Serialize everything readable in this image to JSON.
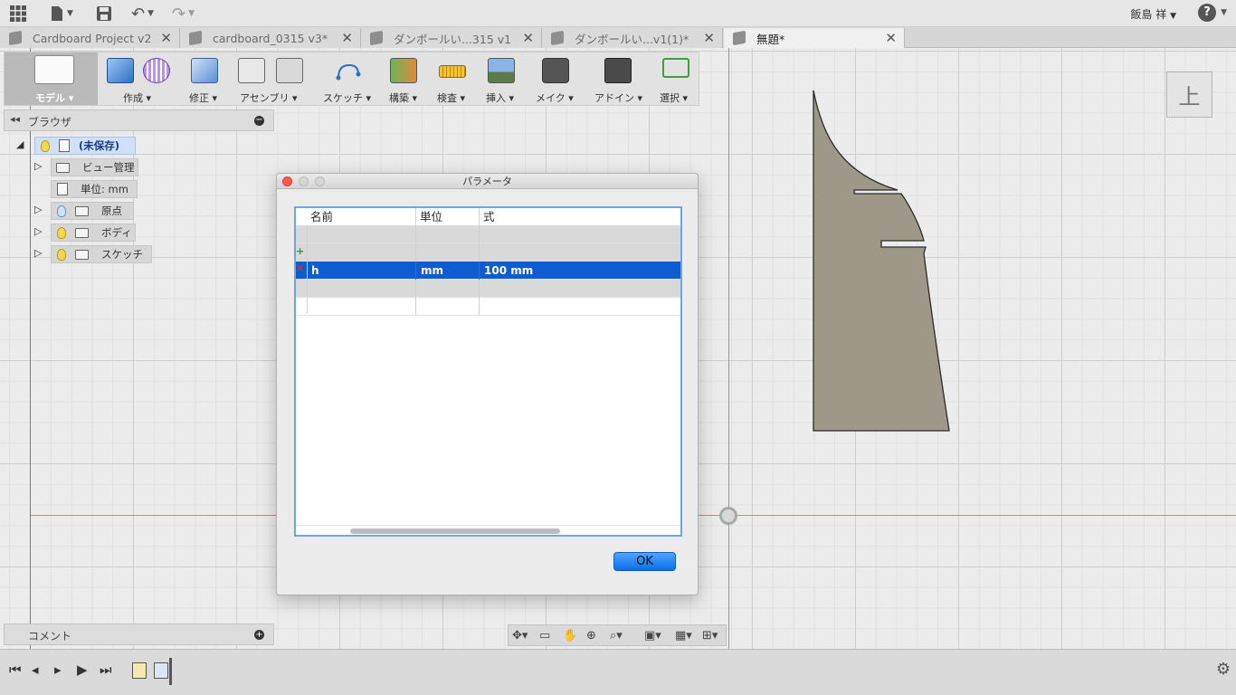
{
  "header": {
    "user_name": "飯島 祥",
    "help_label": "?"
  },
  "tabs": [
    {
      "label": "Cardboard Project v2"
    },
    {
      "label": "cardboard_0315 v3*"
    },
    {
      "label": "ダンボールい...315 v1"
    },
    {
      "label": "ダンボールい...v1(1)*"
    },
    {
      "label": "無題*"
    }
  ],
  "toolbar": {
    "model": "モデル ▾",
    "create": "作成 ▾",
    "modify": "修正 ▾",
    "assembly": "アセンブリ ▾",
    "sketch": "スケッチ ▾",
    "construct": "構築 ▾",
    "inspect": "検査 ▾",
    "insert": "挿入 ▾",
    "make": "メイク ▾",
    "addins": "アドイン ▾",
    "select": "選択 ▾"
  },
  "browser": {
    "title": "ブラウザ",
    "items": [
      {
        "label": "(未保存)"
      },
      {
        "label": "ビュー管理"
      },
      {
        "label": "単位: mm"
      },
      {
        "label": "原点"
      },
      {
        "label": "ボディ"
      },
      {
        "label": "スケッチ"
      }
    ]
  },
  "comment": {
    "title": "コメント"
  },
  "viewcube": {
    "face": "上"
  },
  "dialog": {
    "title": "パラメータ",
    "columns": {
      "name": "名前",
      "unit": "単位",
      "expr": "式"
    },
    "parameter": {
      "name": "h",
      "unit": "mm",
      "expr": "100 mm"
    },
    "ok_label": "OK"
  },
  "colors": {
    "selection": "#0f5cd1",
    "sketch_fill": "#9e9888",
    "x_axis": "#e07c7c",
    "y_axis": "#8c8ce0"
  }
}
